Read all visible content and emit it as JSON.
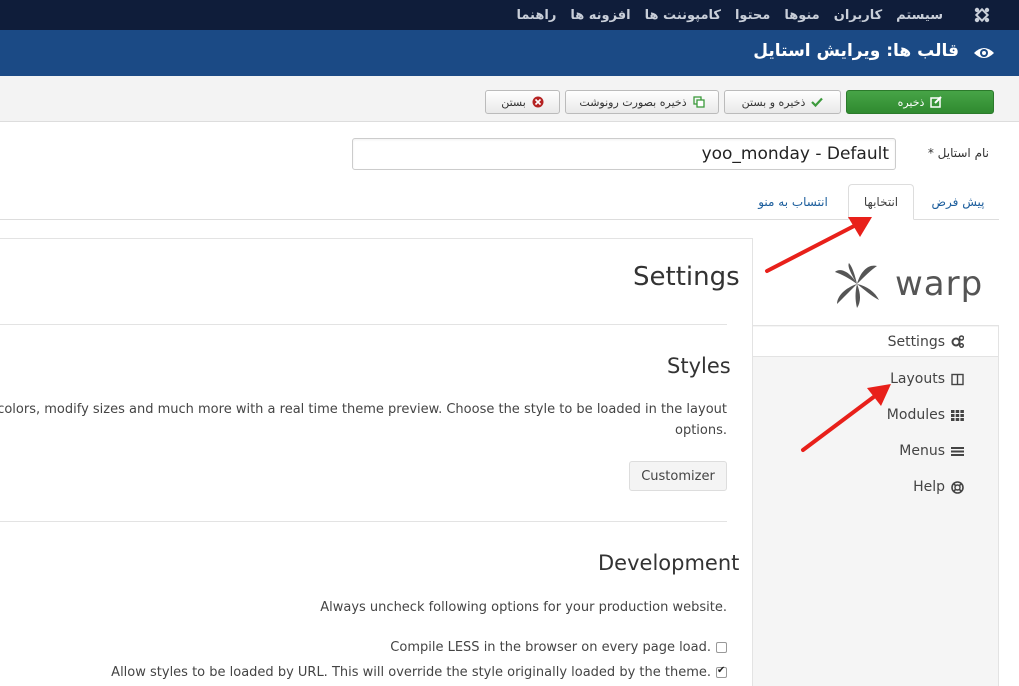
{
  "topnav": {
    "items": [
      "سیستم",
      "کاربران",
      "منوها",
      "محتوا",
      "کامپوننت ها",
      "افزونه ها",
      "راهنما"
    ]
  },
  "header": {
    "title": "قالب ها: ویرایش استایل"
  },
  "toolbar": {
    "save": "ذخیره",
    "save_close": "ذخیره و بستن",
    "save_copy": "ذخیره بصورت رونوشت",
    "close": "بستن"
  },
  "form": {
    "style_name_label": "نام استایل *",
    "style_name_value": "yoo_monday - Default"
  },
  "tabs": [
    "پیش فرض",
    "انتخابها",
    "انتساب به منو"
  ],
  "sidebar": {
    "logo": "warp",
    "items": [
      {
        "label": "Settings",
        "icon": "gears-icon"
      },
      {
        "label": "Layouts",
        "icon": "columns-icon"
      },
      {
        "label": "Modules",
        "icon": "grid-icon"
      },
      {
        "label": "Menus",
        "icon": "list-icon"
      },
      {
        "label": "Help",
        "icon": "lifebuoy-icon"
      }
    ]
  },
  "main": {
    "title": "Settings",
    "styles_heading": "Styles",
    "styles_text_line1": "pick colors, modify sizes and much more with a real time theme preview. Choose the style to be loaded in the layout",
    "styles_text_line2": "options.",
    "customizer_button": "Customizer",
    "dev_heading": "Development",
    "dev_text": "Always uncheck following options for your production website.",
    "option1": "Compile LESS in the browser on every page load.",
    "option1_checked": false,
    "option2": "Allow styles to be loaded by URL. This will override the style originally loaded by the theme.",
    "option2_checked": true
  },
  "colors": {
    "topnav_bg": "#0f1d3a",
    "header_bg": "#1b4a85",
    "save_btn": "#3c9a3c",
    "arrow": "#e8201a",
    "link": "#1b5d9c"
  }
}
